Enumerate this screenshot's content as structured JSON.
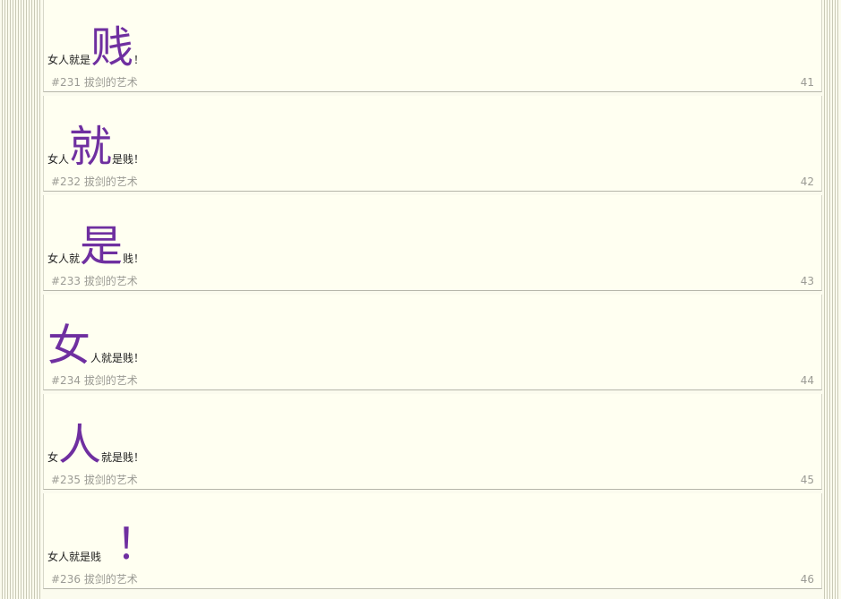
{
  "posts": [
    {
      "before": "女人就是",
      "highlight": "贱",
      "after": "！",
      "meta": "#231 拔剑的艺术",
      "page": "41"
    },
    {
      "before": "女人",
      "highlight": "就",
      "after": "是贱！",
      "meta": "#232 拔剑的艺术",
      "page": "42"
    },
    {
      "before": "女人就",
      "highlight": "是",
      "after": "贱！",
      "meta": "#233 拔剑的艺术",
      "page": "43"
    },
    {
      "before": "",
      "highlight": "女",
      "after": "人就是贱！",
      "meta": "#234 拔剑的艺术",
      "page": "44"
    },
    {
      "before": "女",
      "highlight": "人",
      "after": "就是贱！",
      "meta": "#235 拔剑的艺术",
      "page": "45"
    },
    {
      "before": "女人就是贱",
      "highlight": "！",
      "after": "",
      "meta": "#236 拔剑的艺术",
      "page": "46"
    }
  ]
}
